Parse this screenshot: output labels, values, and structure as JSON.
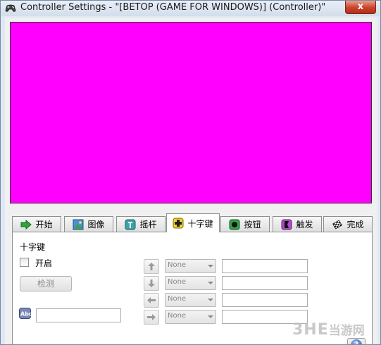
{
  "window": {
    "title": "Controller Settings - \"[BETOP (GAME FOR WINDOWS)] (Controller)\"",
    "close_label": "x",
    "preview_color": "#ff00ff"
  },
  "tabs": [
    {
      "label": "开始",
      "icon": "arrow-right-icon"
    },
    {
      "label": "图像",
      "icon": "picture-icon"
    },
    {
      "label": "摇杆",
      "icon": "joystick-icon"
    },
    {
      "label": "十字键",
      "icon": "dpad-icon",
      "active": true
    },
    {
      "label": "按钮",
      "icon": "button-icon"
    },
    {
      "label": "触发",
      "icon": "trigger-icon"
    },
    {
      "label": "完成",
      "icon": "finish-flag-icon"
    }
  ],
  "dpad_panel": {
    "section_title": "十字键",
    "enable_label": "开启",
    "enable_checked": false,
    "detect_button": "检测",
    "name_value": "",
    "directions": [
      {
        "direction": "up",
        "icon": "arrow-up-icon",
        "combo": "None",
        "mapping": ""
      },
      {
        "direction": "down",
        "icon": "arrow-down-icon",
        "combo": "None",
        "mapping": ""
      },
      {
        "direction": "left",
        "icon": "arrow-left-icon",
        "combo": "None",
        "mapping": ""
      },
      {
        "direction": "right",
        "icon": "arrow-right-icon",
        "combo": "None",
        "mapping": ""
      }
    ],
    "help_label": "?"
  },
  "watermark": {
    "latin": "3HE",
    "chinese": "当游网"
  }
}
